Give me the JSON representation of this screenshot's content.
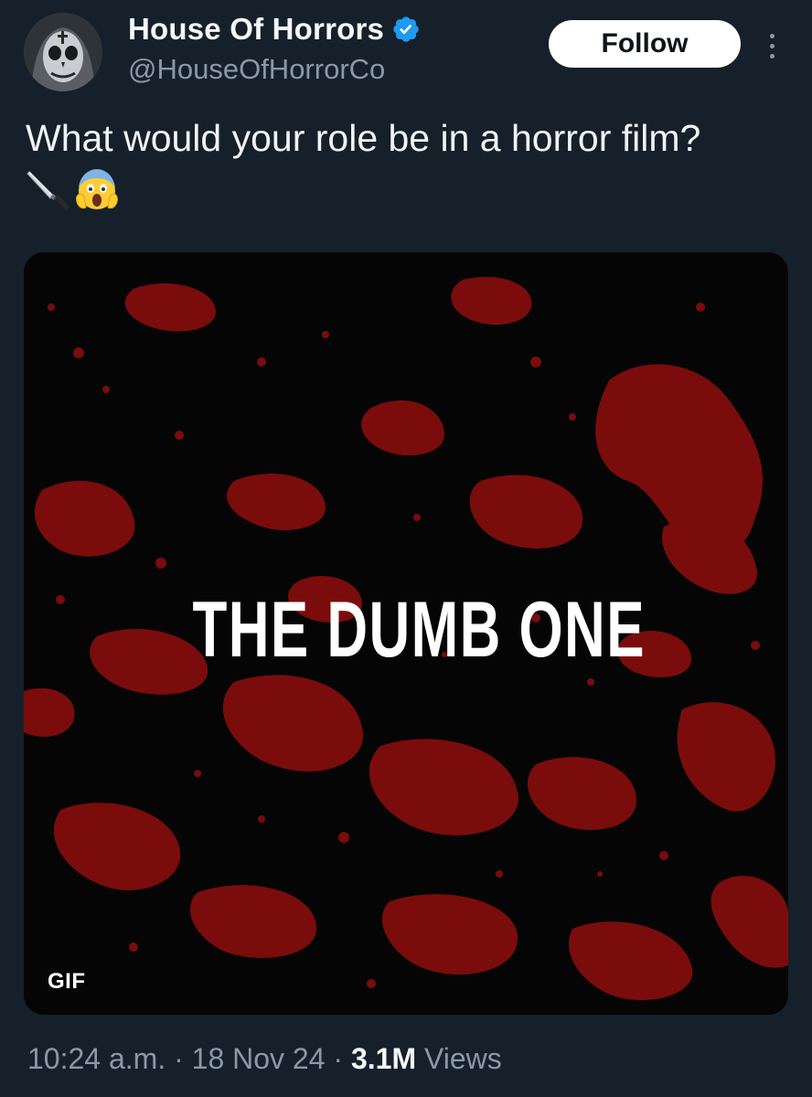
{
  "author": {
    "display_name": "House Of Horrors",
    "handle": "@HouseOfHorrorCo",
    "verified": true,
    "avatar_icon": "skull-face-avatar"
  },
  "actions": {
    "follow_label": "Follow",
    "more_icon": "vertical-ellipsis-icon"
  },
  "tweet": {
    "text": "What would your role be in a horror film?",
    "emojis": [
      "knife-emoji",
      "screaming-face-emoji"
    ]
  },
  "media": {
    "caption": "THE DUMB ONE",
    "badge": "GIF",
    "colors": {
      "background": "#050505",
      "splatter": "#7a0c0c"
    }
  },
  "meta": {
    "time": "10:24 a.m.",
    "separator": "·",
    "date": "18 Nov 24",
    "views_count": "3.1M",
    "views_label": "Views"
  },
  "colors": {
    "page_background": "#15202b",
    "verified_badge": "#1d9bf0",
    "secondary_text": "#8b98a5"
  }
}
